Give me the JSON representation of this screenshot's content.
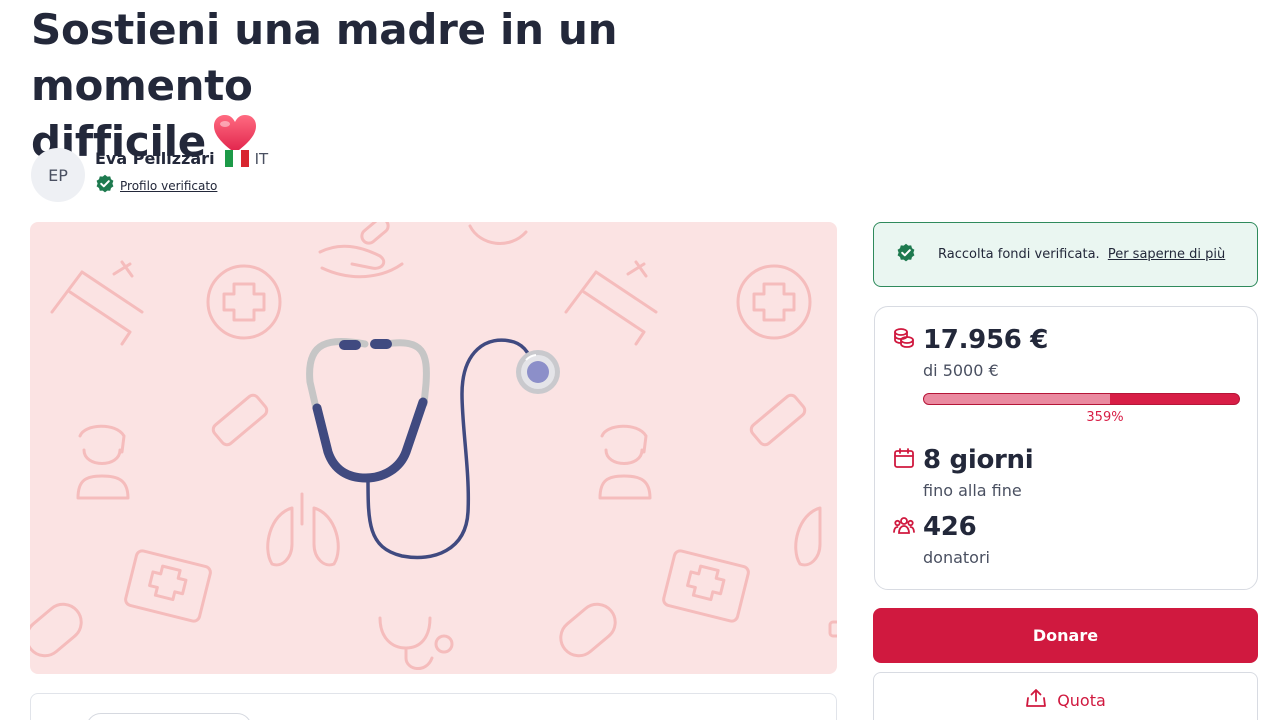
{
  "campaign": {
    "title_line1": "Sostieni una madre in un momento",
    "title_line2": "difficile"
  },
  "author": {
    "initials": "EP",
    "name": "Eva Pellizzari",
    "country": "IT",
    "verified_label": "Profilo verificato"
  },
  "notice": {
    "text": "Raccolta fondi verificata.",
    "link": "Per saperne di più"
  },
  "stats": {
    "raised": "17.956 €",
    "goal": "di 5000 €",
    "percent": "359%",
    "progress_fill_fraction": 0.59,
    "days": "8 giorni",
    "days_sub": "fino alla fine",
    "donors": "426",
    "donors_sub": "donatori"
  },
  "actions": {
    "donate": "Donare",
    "share": "Quota"
  },
  "colors": {
    "accent": "#d0193f",
    "verified_green": "#1e7a4f",
    "hero_bg": "#fbe3e3",
    "hero_pattern": "#f4b9b9"
  },
  "icons": [
    "heart-icon",
    "verified-check-icon",
    "coins-icon",
    "calendar-icon",
    "donors-icon",
    "share-icon",
    "stethoscope-illustration"
  ]
}
